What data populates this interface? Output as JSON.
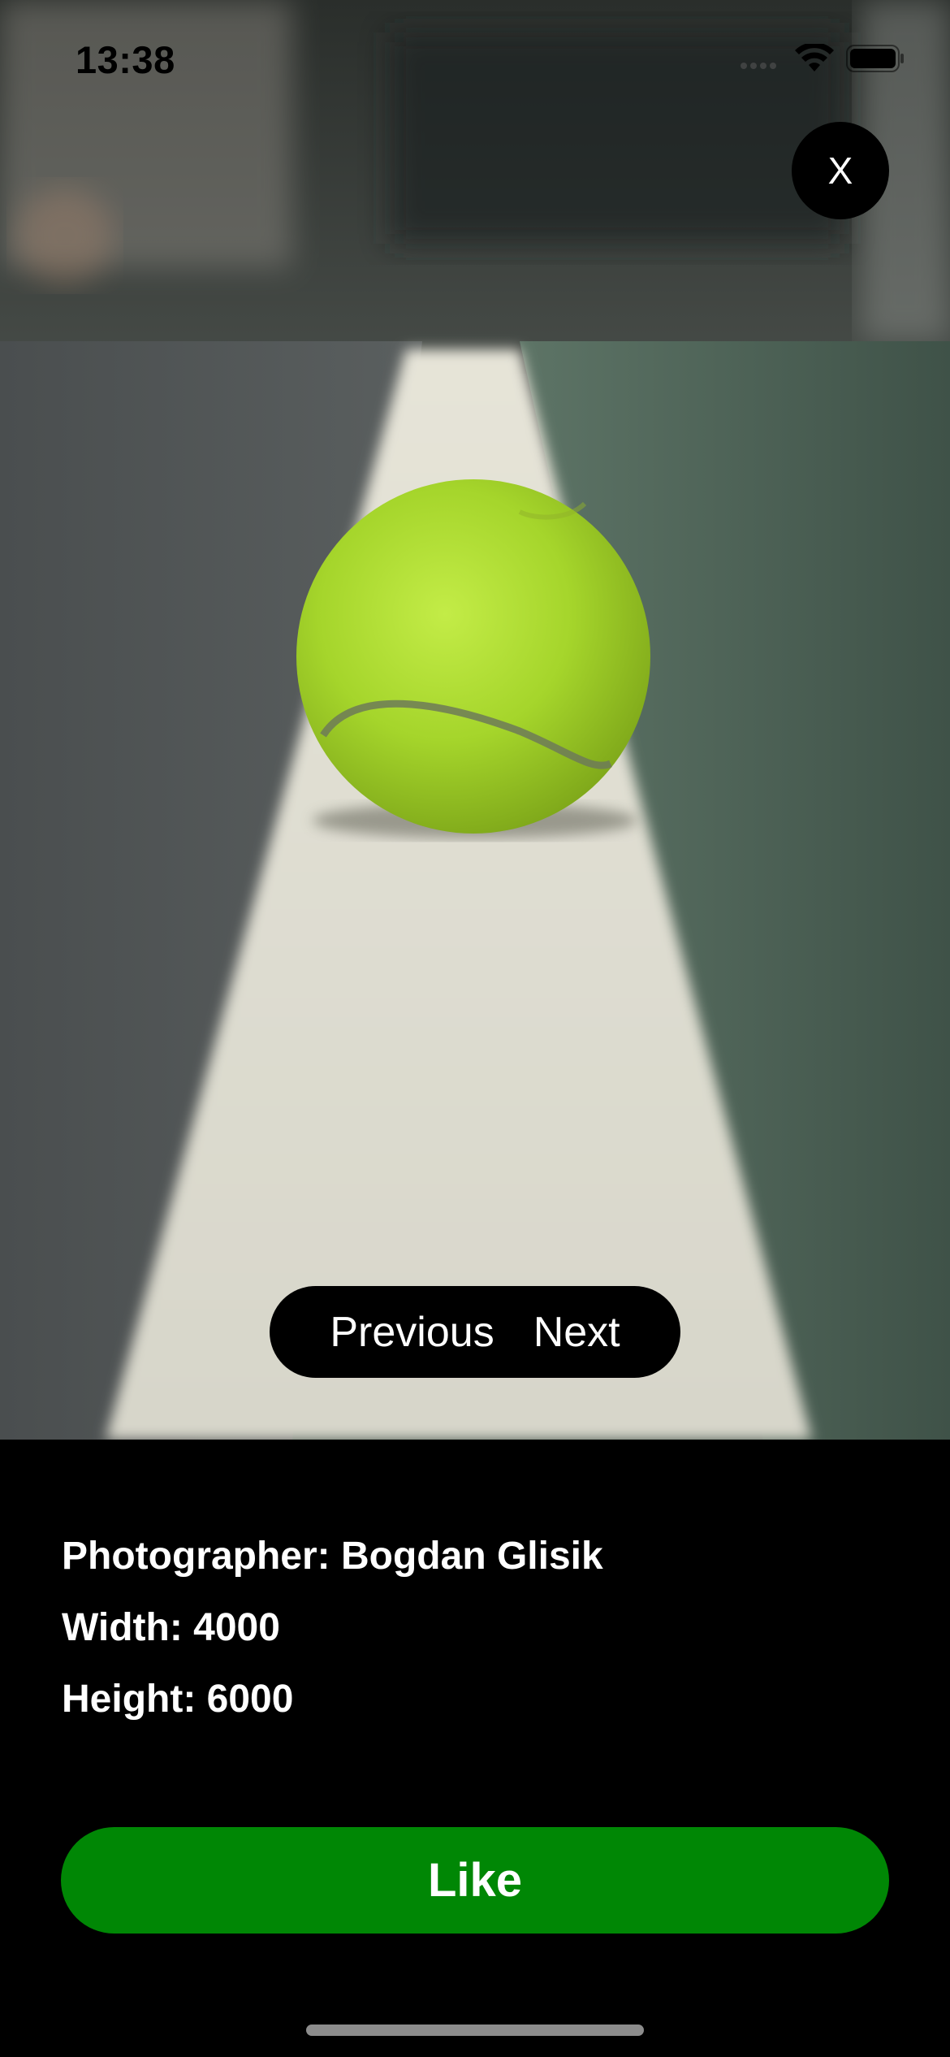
{
  "status_bar": {
    "time": "13:38",
    "icons": [
      "signal-icon",
      "wifi-icon",
      "battery-icon"
    ]
  },
  "photo": {
    "subject": "tennis-ball-on-court-line",
    "icon": "photo-icon"
  },
  "close_button": {
    "label": "X"
  },
  "navigation": {
    "previous_label": "Previous",
    "next_label": "Next"
  },
  "info": {
    "photographer": "Photographer: Bogdan Glisik",
    "width": "Width: 4000",
    "height": "Height: 6000"
  },
  "like_button": {
    "label": "Like"
  },
  "colors": {
    "like_green": "#008705",
    "background": "#000000",
    "ball_yellow": "#a7d82c",
    "court_green": "#4b5c52"
  }
}
